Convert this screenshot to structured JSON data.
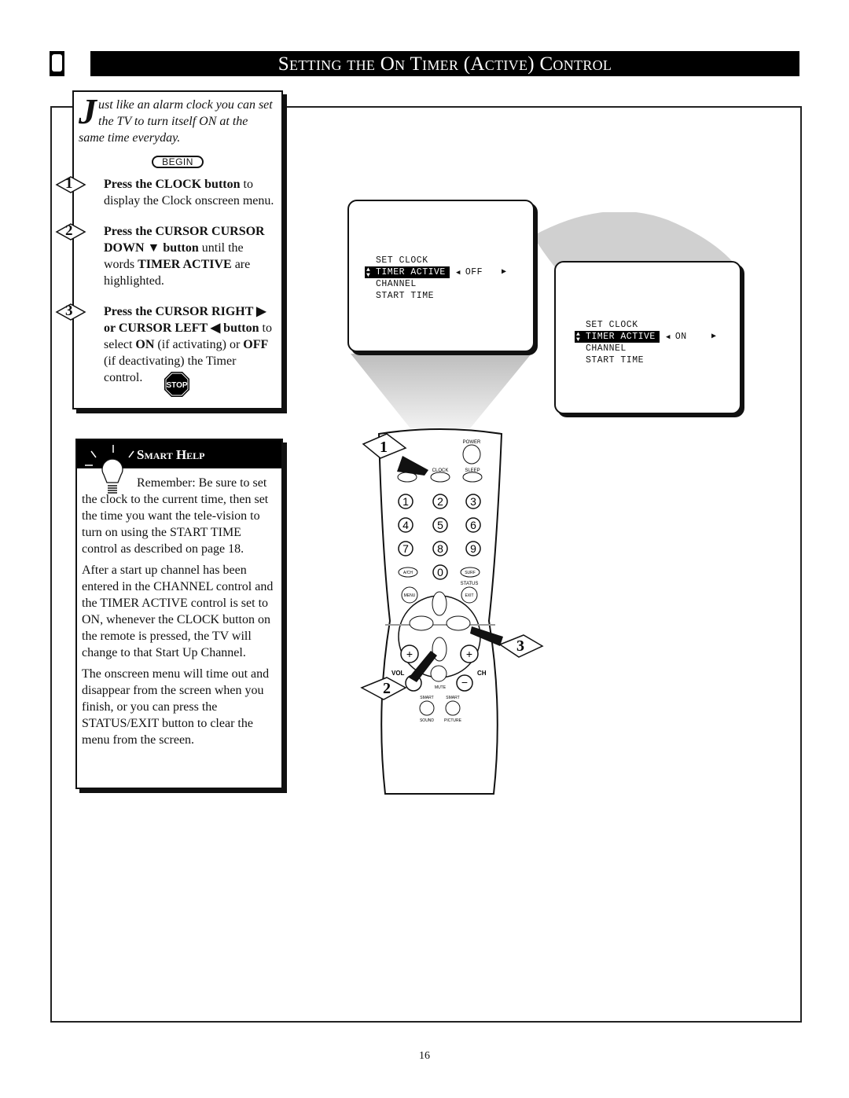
{
  "header": {
    "title": "Setting the On Timer (Active) Control"
  },
  "intro": {
    "lead_dropcap": "J",
    "lead_text": "ust like an alarm clock you can set the TV to turn itself ON at the same time everyday.",
    "begin_label": "BEGIN",
    "steps": [
      {
        "number": "1",
        "bold": "Press the CLOCK button",
        "text": " to display the Clock onscreen menu."
      },
      {
        "number": "2",
        "bold": "Press the CURSOR CURSOR DOWN ▼ button",
        "text": " until the words ",
        "bold2": "TIMER ACTIVE",
        "text2": " are highlighted."
      },
      {
        "number": "3",
        "bold": "Press the CURSOR RIGHT ▶ or CURSOR LEFT ◀ button",
        "text": " to select ",
        "bold2": "ON",
        "text2": " (if activating) or ",
        "bold3": "OFF",
        "text3": " (if deactivating) the Timer control."
      }
    ],
    "stop_label": "STOP"
  },
  "smart_help": {
    "title": "Smart Help",
    "paragraphs": [
      "Remember: Be sure to set the clock to the current time, then set the time you want the tele-vision to turn on using the START TIME control as described on page 18.",
      "After a start up channel has been entered in the CHANNEL control and the TIMER ACTIVE control is set to ON, whenever the CLOCK button on the remote is pressed, the TV will change to that Start Up Channel.",
      "The onscreen menu will time out and disappear from the screen when you finish, or you can press the STATUS/EXIT button to clear the menu from the screen."
    ]
  },
  "screens": [
    {
      "items": [
        "SET CLOCK",
        "TIMER ACTIVE",
        "CHANNEL",
        "START TIME"
      ],
      "highlighted": "TIMER ACTIVE",
      "value": "OFF"
    },
    {
      "items": [
        "SET CLOCK",
        "TIMER ACTIVE",
        "CHANNEL",
        "START TIME"
      ],
      "highlighted": "TIMER ACTIVE",
      "value": "ON"
    }
  ],
  "remote": {
    "power": "POWER",
    "clock": "CLOCK",
    "sleep": "SLEEP",
    "digits": [
      "1",
      "2",
      "3",
      "4",
      "5",
      "6",
      "7",
      "8",
      "9",
      "0"
    ],
    "ach": "A/CH",
    "surf": "SURF",
    "status": "STATUS",
    "exit": "EXIT",
    "menu": "MENU",
    "vol": "VOL",
    "ch": "CH",
    "mute": "MUTE",
    "smart1": "SMART",
    "smart2": "SMART",
    "sound": "SOUND",
    "picture": "PICTURE",
    "callouts": [
      "1",
      "2",
      "3"
    ]
  },
  "page_number": "16"
}
